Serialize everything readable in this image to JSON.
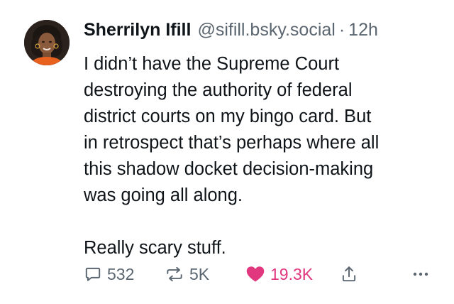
{
  "post": {
    "author": {
      "name": "Sherrilyn Ifill",
      "handle": "@sifill.bsky.social",
      "separator": "·",
      "time": "12h"
    },
    "text": "I didn’t have the Supreme Court\ndestroying the authority of federal\ndistrict courts on my bingo card. But\nin retrospect that’s perhaps where all\nthis shadow docket decision-making\nwas going all along.",
    "text_second": "Really scary stuff.",
    "actions": {
      "reply_count": "532",
      "repost_count": "5K",
      "like_count": "19.3K",
      "icons": [
        "reply-icon",
        "repost-icon",
        "heart-icon",
        "share-icon",
        "more-icon"
      ]
    },
    "colors": {
      "text": "#0f1419",
      "muted": "#5b6670",
      "like": "#e0377f"
    }
  }
}
